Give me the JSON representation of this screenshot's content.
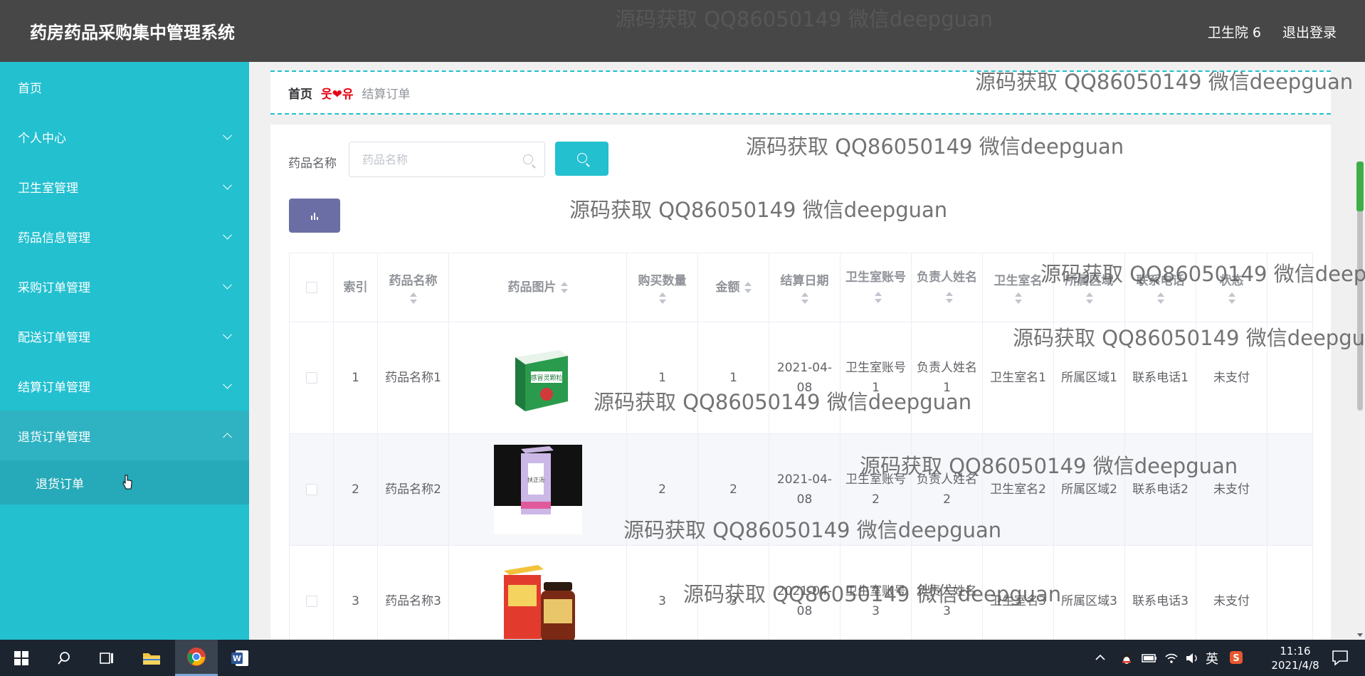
{
  "header": {
    "title": "药房药品采购集中管理系统",
    "user": "卫生院 6",
    "logout": "退出登录"
  },
  "sidebar": {
    "items": [
      {
        "label": "首页"
      },
      {
        "label": "个人中心"
      },
      {
        "label": "卫生室管理"
      },
      {
        "label": "药品信息管理"
      },
      {
        "label": "采购订单管理"
      },
      {
        "label": "配送订单管理"
      },
      {
        "label": "结算订单管理"
      },
      {
        "label": "退货订单管理"
      }
    ],
    "sub_item": "退货订单"
  },
  "breadcrumb": {
    "home": "首页",
    "separator": "웃❤유",
    "current": "结算订单"
  },
  "search": {
    "label": "药品名称",
    "placeholder": "药品名称"
  },
  "table": {
    "columns": [
      "索引",
      "药品名称",
      "药品图片",
      "购买数量",
      "金额",
      "结算日期",
      "卫生室账号",
      "负责人姓名",
      "卫生室名",
      "所属区域",
      "联系电话",
      "状态"
    ],
    "rows": [
      {
        "index": "1",
        "name": "药品名称1",
        "qty": "1",
        "amount": "1",
        "date": "2021-04-08",
        "account": "卫生室账号1",
        "person": "负责人姓名1",
        "room": "卫生室名1",
        "area": "所属区域1",
        "phone": "联系电话1",
        "status": "未支付"
      },
      {
        "index": "2",
        "name": "药品名称2",
        "qty": "2",
        "amount": "2",
        "date": "2021-04-08",
        "account": "卫生室账号2",
        "person": "负责人姓名2",
        "room": "卫生室名2",
        "area": "所属区域2",
        "phone": "联系电话2",
        "status": "未支付"
      },
      {
        "index": "3",
        "name": "药品名称3",
        "qty": "3",
        "amount": "3",
        "date": "2021-04-08",
        "account": "卫生室账号3",
        "person": "负责人姓名3",
        "room": "卫生室名3",
        "area": "所属区域3",
        "phone": "联系电话3",
        "status": "未支付"
      }
    ],
    "product_box_text": [
      "感冒灵颗粒",
      "扶正汤"
    ]
  },
  "watermark": "源码获取 QQ86050149 微信deepguan",
  "taskbar": {
    "time": "11:16",
    "date": "2021/4/8",
    "ime": "英"
  },
  "colors": {
    "accent": "#23c0d0",
    "header_bg": "#474747",
    "stats_button": "#6b6ea5"
  }
}
